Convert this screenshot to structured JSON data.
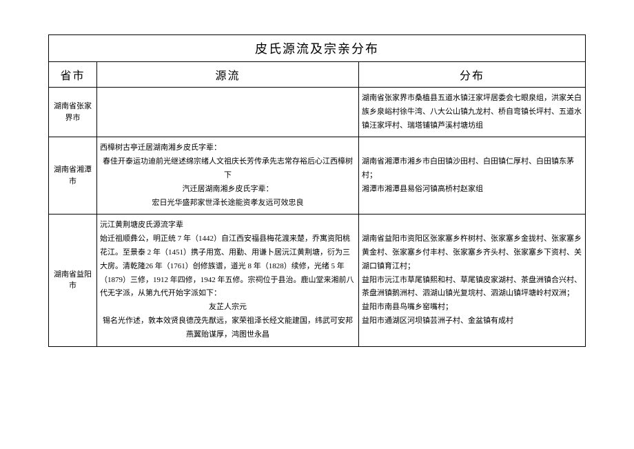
{
  "title": "皮氏源流及宗亲分布",
  "headers": {
    "province": "省市",
    "source": "源流",
    "distribution": "分布"
  },
  "rows": [
    {
      "province": "湖南省张家界市",
      "source": "",
      "distribution": "湖南省张家界市桑植县五道水镇汪家坪居委会七眼泉组，洪家关白族乡泉峪村徐牛湾、八大公山镇九龙村、桥自弯镇长坪村、五道水镇汪家坪村、瑞塔铺镇芦溪村塘坊组"
    },
    {
      "province": "湖南省湘潭市",
      "source_lines": [
        "西樟树古亭迁居湖南湘乡皮氏字辈：",
        "春佳开泰运功迪前光继述绵宗绪人文祖庆长芳传承先志常存裕后心江西樟树下",
        "汽迁居湖南湘乡皮氏字辈：",
        "宏日光华盛邦家世泽长途能资孝友远可效忠良"
      ],
      "distribution": "湖南省湘潭市湘乡市白田镇沙田村、白田镇仁厚村、白田镇东茅村；\n湘潭市湘潭县易俗河镇高桥村赵家组"
    },
    {
      "province": "湖南省益阳市",
      "source_lines": [
        "沅江黄荆塘皮氏源流字辈",
        "始迁祖顺彝公，明正统 7 年（1442）自江西安福县梅花渡来楚，乔寓资阳桃花江。至景泰 2 年（1451）携子用宽、用勤、用谦卜居沅江黄荆塘，衍为三大房。清乾隆26 年（1761）创修族谱，道光 8 年（1828）续修，光绪 5 年（1879）三修，1912 年四修，1942 年五修。宗祠位于县治。鹿山堂来湘前八代无字派，从第九代开始字派如下：",
        "友芷人宗元",
        "锡名光作述，敦本效贤良德茂先猷远，家荣祖泽长经文能建国，纬武可安邦燕翼贻谋厚，鸿图世永昌"
      ],
      "distribution": "湖南省益阳市资阳区张家塞乡杵树村、张家塞乡金拢村、张家塞乡黄金村、张家塞乡付丰村、张家塞乡齐头村、张家塞乡下资村、关湖口镇育江村；\n益阳市沅江市草尾镇熙和村、草尾镇皮家湖村、茶盘洲镇合兴村、茶盘洲镇鹅洲村、泗湖山镇光复垸村、泗湖山镇坪塘岭村双洲；\n益阳市南县鸟嘴乡窑嘴村；\n益阳市通湖区河坝镇芸洲子村、金盆镇有成村"
    }
  ]
}
